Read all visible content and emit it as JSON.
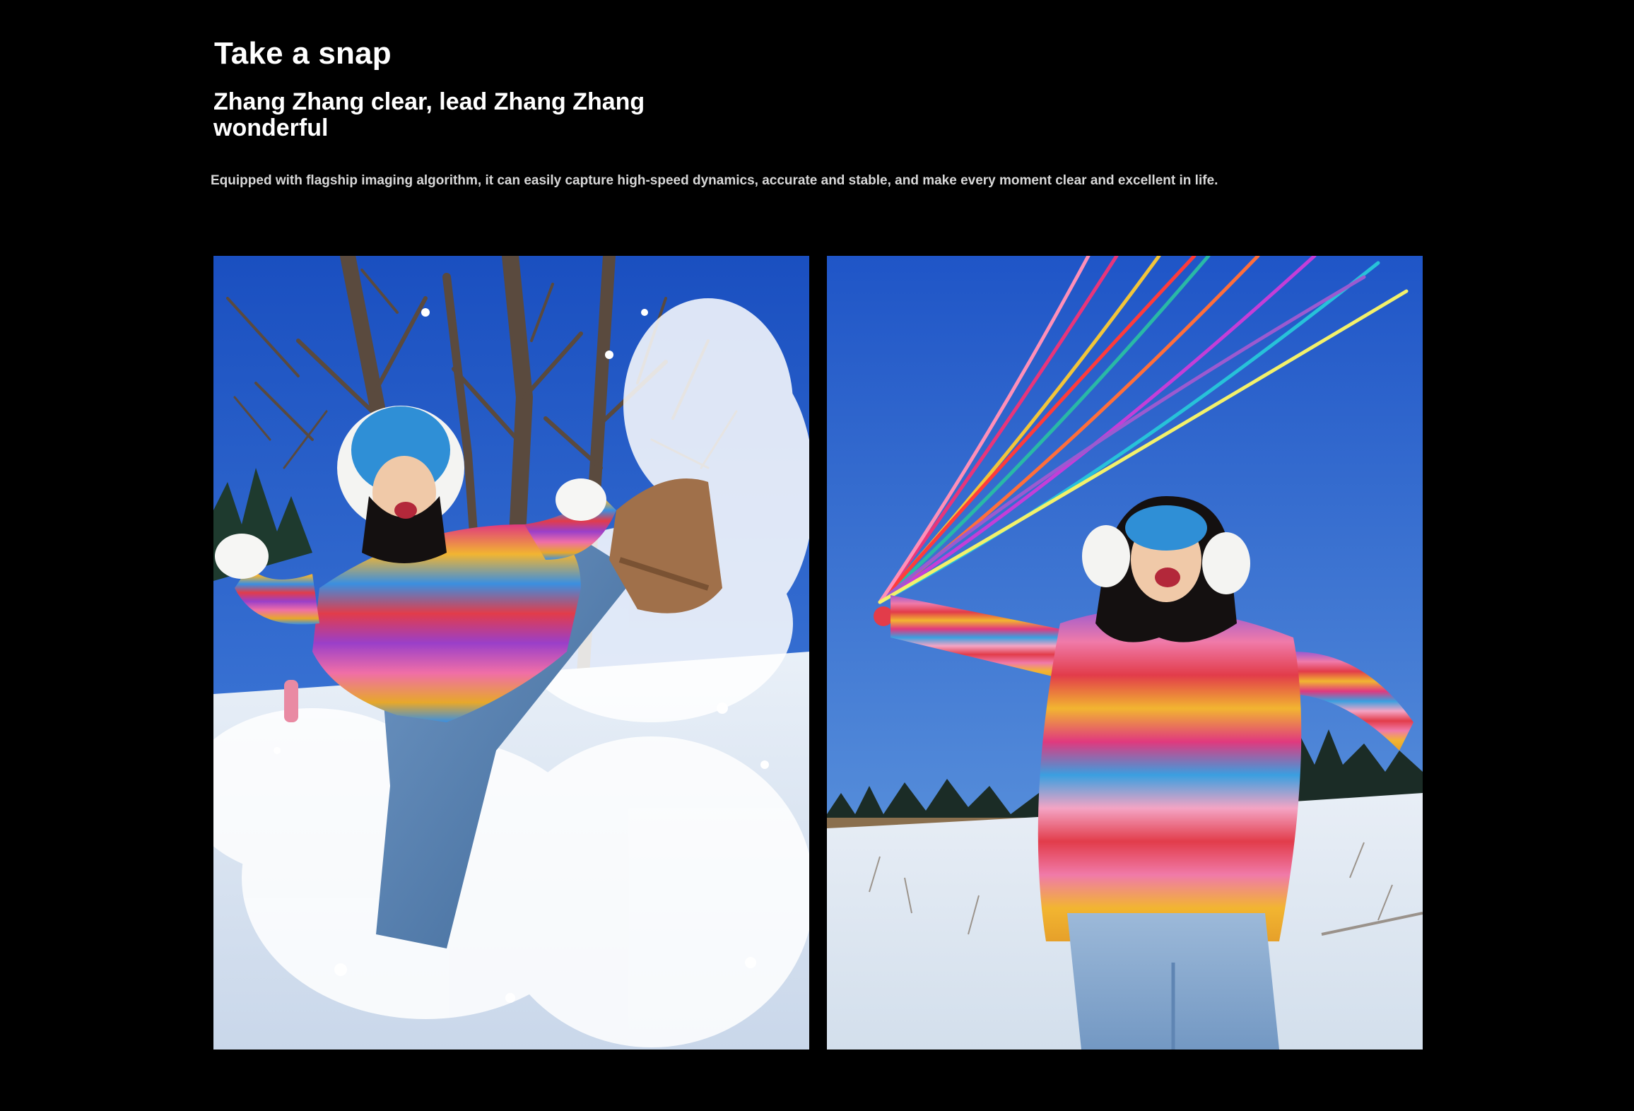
{
  "header": {
    "title": "Take a snap",
    "subtitle": "Zhang Zhang clear, lead Zhang Zhang wonderful",
    "description": "Equipped with flagship imaging algorithm, it can easily capture high-speed dynamics, accurate and stable, and make every moment clear and excellent in life."
  },
  "gallery": {
    "photos": [
      {
        "subject": "woman-kicking-snow",
        "colors": {
          "sky": "#1f5fd0",
          "snow": "#f2f6fb",
          "sweater": "#e23c7a"
        }
      },
      {
        "subject": "woman-with-ribbons",
        "colors": {
          "sky": "#2a67d3",
          "snow": "#eef3f8",
          "sweater": "#e8427a"
        }
      }
    ]
  }
}
